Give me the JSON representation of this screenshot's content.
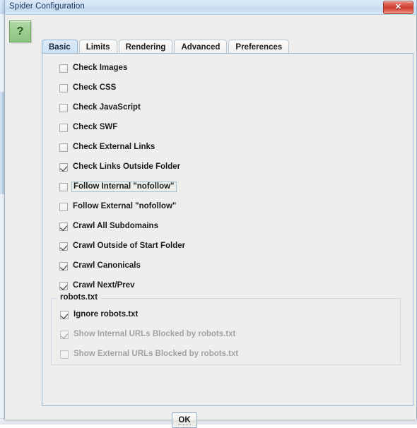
{
  "window": {
    "title": "Spider Configuration",
    "close_label": "✕",
    "help_label": "?"
  },
  "background": {
    "menu_items": [
      "",
      "",
      "",
      "",
      "",
      "",
      ""
    ]
  },
  "tabs": [
    {
      "label": "Basic",
      "selected": true
    },
    {
      "label": "Limits",
      "selected": false
    },
    {
      "label": "Rendering",
      "selected": false
    },
    {
      "label": "Advanced",
      "selected": false
    },
    {
      "label": "Preferences",
      "selected": false
    }
  ],
  "basic_tab": {
    "options": [
      {
        "label": "Check Images",
        "checked": false,
        "enabled": true,
        "focused": false
      },
      {
        "label": "Check CSS",
        "checked": false,
        "enabled": true,
        "focused": false
      },
      {
        "label": "Check JavaScript",
        "checked": false,
        "enabled": true,
        "focused": false
      },
      {
        "label": "Check SWF",
        "checked": false,
        "enabled": true,
        "focused": false
      },
      {
        "label": "Check External Links",
        "checked": false,
        "enabled": true,
        "focused": false
      },
      {
        "label": "Check Links Outside Folder",
        "checked": true,
        "enabled": true,
        "focused": false
      },
      {
        "label": "Follow Internal \"nofollow\"",
        "checked": false,
        "enabled": true,
        "focused": true
      },
      {
        "label": "Follow External \"nofollow\"",
        "checked": false,
        "enabled": true,
        "focused": false
      },
      {
        "label": "Crawl All Subdomains",
        "checked": true,
        "enabled": true,
        "focused": false
      },
      {
        "label": "Crawl Outside of Start Folder",
        "checked": true,
        "enabled": true,
        "focused": false
      },
      {
        "label": "Crawl Canonicals",
        "checked": true,
        "enabled": true,
        "focused": false
      },
      {
        "label": "Crawl Next/Prev",
        "checked": true,
        "enabled": true,
        "focused": false
      }
    ],
    "robots_group": {
      "title": "robots.txt",
      "options": [
        {
          "label": "Ignore robots.txt",
          "checked": true,
          "enabled": true
        },
        {
          "label": "Show Internal URLs Blocked by robots.txt",
          "checked": true,
          "enabled": false
        },
        {
          "label": "Show External URLs Blocked by robots.txt",
          "checked": false,
          "enabled": false
        }
      ]
    }
  },
  "footer": {
    "ok_label": "OK"
  },
  "colors": {
    "dialog_bg": "#eeeeec",
    "titlebar": "#d2e3f5",
    "panel_border": "#9bb8d6",
    "tab_selected": "#cde2f5",
    "close_button": "#cf3f30",
    "help_button": "#9ccd90",
    "text": "#1b1b1b",
    "disabled_text": "#a2a2a2"
  }
}
